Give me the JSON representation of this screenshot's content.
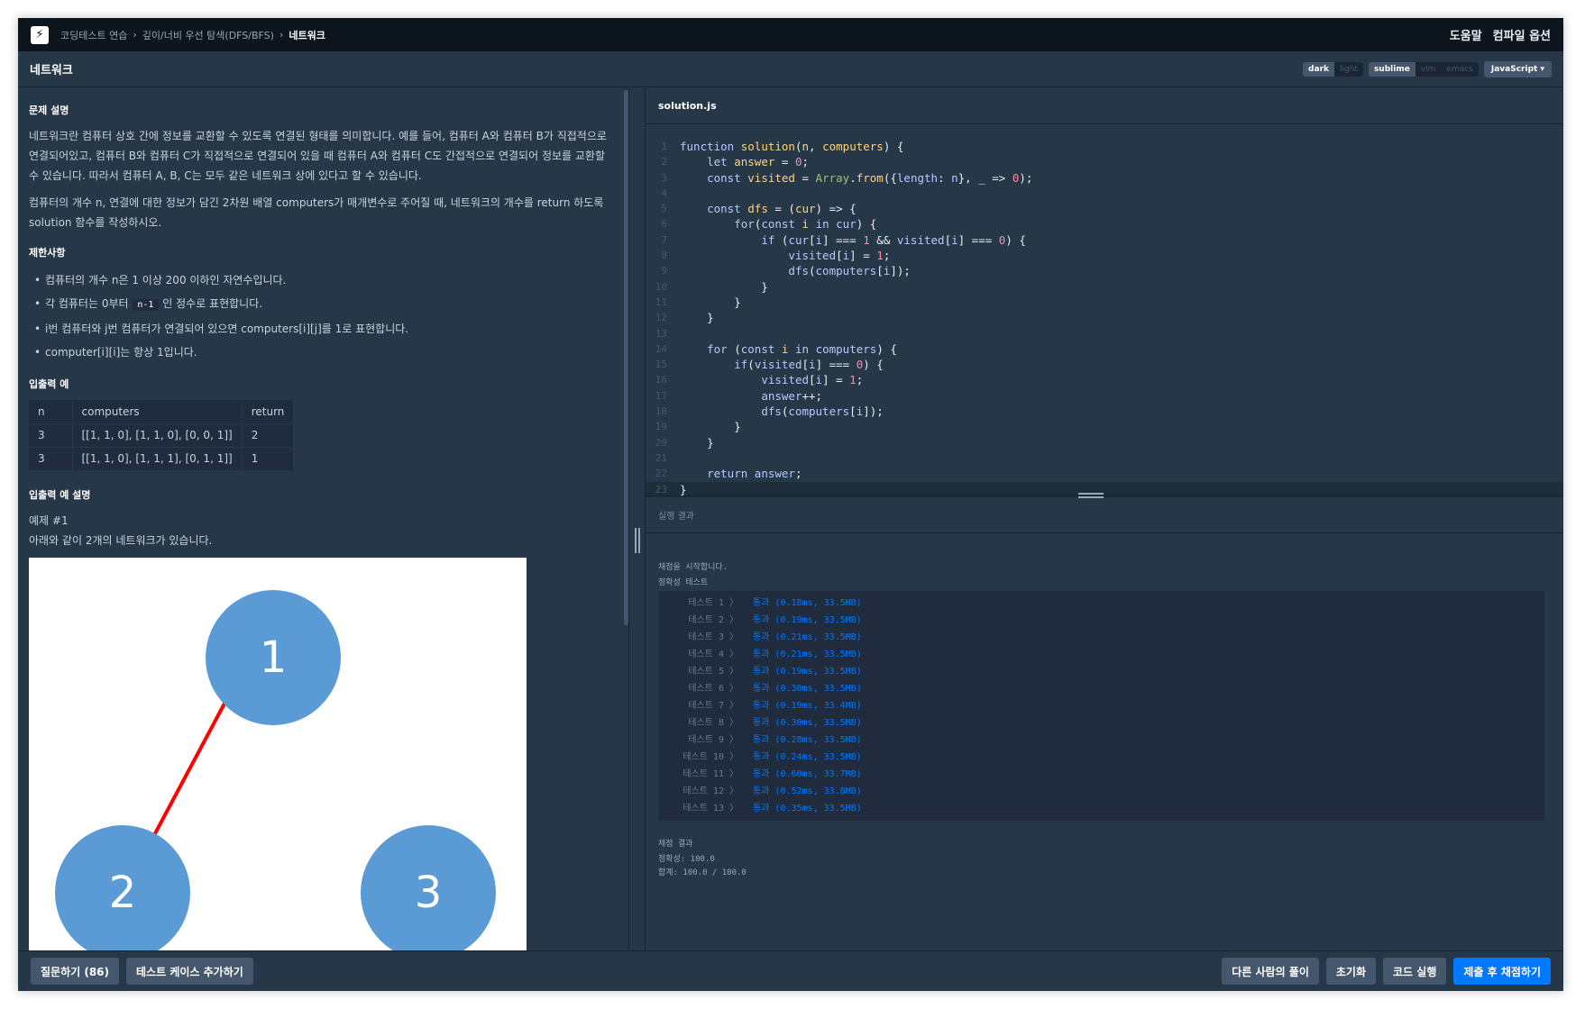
{
  "topbar": {
    "breadcrumb": [
      "코딩테스트 연습",
      "깊이/너비 우선 탐색(DFS/BFS)",
      "네트워크"
    ],
    "links": [
      "도움말",
      "컴파일 옵션"
    ]
  },
  "title": "네트워크",
  "settings": {
    "themes": [
      "dark",
      "light"
    ],
    "active_theme": "dark",
    "keymaps": [
      "sublime",
      "vim",
      "emacs"
    ],
    "active_keymap": "sublime",
    "language": "JavaScript"
  },
  "problem": {
    "desc_heading": "문제 설명",
    "desc_p1": "네트워크란 컴퓨터 상호 간에 정보를 교환할 수 있도록 연결된 형태를 의미합니다. 예를 들어, 컴퓨터 A와 컴퓨터 B가 직접적으로 연결되어있고, 컴퓨터 B와 컴퓨터 C가 직접적으로 연결되어 있을 때 컴퓨터 A와 컴퓨터 C도 간접적으로 연결되어 정보를 교환할 수 있습니다. 따라서 컴퓨터 A, B, C는 모두 같은 네트워크 상에 있다고 할 수 있습니다.",
    "desc_p2": "컴퓨터의 개수 n, 연결에 대한 정보가 담긴 2차원 배열 computers가 매개변수로 주어질 때, 네트워크의 개수를 return 하도록 solution 함수를 작성하시오.",
    "constraints_heading": "제한사항",
    "constraints": {
      "c1": "컴퓨터의 개수 n은 1 이상 200 이하인 자연수입니다.",
      "c2_pre": "각 컴퓨터는 0부터",
      "c2_code": "n-1",
      "c2_post": "인 정수로 표현합니다.",
      "c3": "i번 컴퓨터와 j번 컴퓨터가 연결되어 있으면 computers[i][j]를 1로 표현합니다.",
      "c4": "computer[i][i]는 항상 1입니다."
    },
    "io_heading": "입출력 예",
    "io_headers": [
      "n",
      "computers",
      "return"
    ],
    "io_rows": [
      [
        "3",
        "[[1, 1, 0], [1, 1, 0], [0, 0, 1]]",
        "2"
      ],
      [
        "3",
        "[[1, 1, 0], [1, 1, 1], [0, 1, 1]]",
        "1"
      ]
    ],
    "io_explain_heading": "입출력 예 설명",
    "example_label": "예제 #1",
    "example_text": "아래와 같이 2개의 네트워크가 있습니다.",
    "graph_nodes": [
      "1",
      "2",
      "3"
    ]
  },
  "editor": {
    "filename": "solution.js",
    "line_numbers": [
      "1",
      "2",
      "3",
      "4",
      "5",
      "6",
      "7",
      "8",
      "9",
      "10",
      "11",
      "12",
      "13",
      "14",
      "15",
      "16",
      "17",
      "18",
      "19",
      "20",
      "21",
      "22",
      "23"
    ]
  },
  "result": {
    "header": "실행 결과",
    "start": "채점을 시작합니다.",
    "category": "정확성  테스트",
    "tests": [
      {
        "name": "테스트 1 〉",
        "result": "통과 (0.18ms, 33.5MB)"
      },
      {
        "name": "테스트 2 〉",
        "result": "통과 (0.19ms, 33.5MB)"
      },
      {
        "name": "테스트 3 〉",
        "result": "통과 (0.21ms, 33.5MB)"
      },
      {
        "name": "테스트 4 〉",
        "result": "통과 (0.21ms, 33.5MB)"
      },
      {
        "name": "테스트 5 〉",
        "result": "통과 (0.19ms, 33.5MB)"
      },
      {
        "name": "테스트 6 〉",
        "result": "통과 (0.30ms, 33.5MB)"
      },
      {
        "name": "테스트 7 〉",
        "result": "통과 (0.19ms, 33.4MB)"
      },
      {
        "name": "테스트 8 〉",
        "result": "통과 (0.30ms, 33.5MB)"
      },
      {
        "name": "테스트 9 〉",
        "result": "통과 (0.28ms, 33.5MB)"
      },
      {
        "name": "테스트 10 〉",
        "result": "통과 (0.24ms, 33.5MB)"
      },
      {
        "name": "테스트 11 〉",
        "result": "통과 (0.60ms, 33.7MB)"
      },
      {
        "name": "테스트 12 〉",
        "result": "통과 (0.52ms, 33.8MB)"
      },
      {
        "name": "테스트 13 〉",
        "result": "통과 (0.35ms, 33.5MB)"
      }
    ],
    "score_heading": "채점 결과",
    "accuracy": "정확성: 100.0",
    "total": "합계: 100.0 / 100.0"
  },
  "bottom": {
    "ask": "질문하기 (86)",
    "add_testcase": "테스트 케이스 추가하기",
    "others": "다른 사람의 풀이",
    "reset": "초기화",
    "run": "코드 실행",
    "submit": "제출 후 채점하기"
  },
  "colors": {
    "accent": "#0078ff",
    "background": "#263747",
    "topbar": "#0c151c",
    "node": "#5b9bd5",
    "edge": "#ff0000"
  }
}
